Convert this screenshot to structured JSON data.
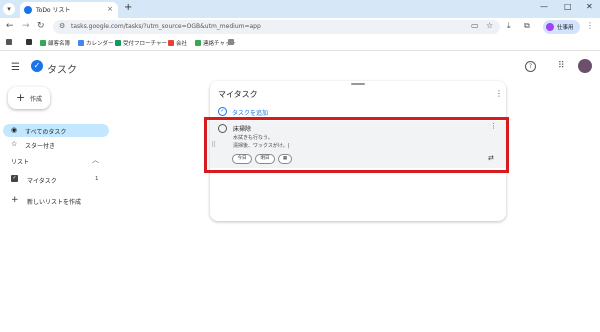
{
  "browser": {
    "tab_title": "ToDo リスト",
    "tab_close": "×",
    "new_tab": "+",
    "url": "tasks.google.com/tasks/?utm_source=OGB&utm_medium=app",
    "profile_label": "仕事用",
    "back": "←",
    "forward": "→",
    "reload": "↻",
    "minimize": "—",
    "maximize": "□",
    "close": "✕"
  },
  "bookmarks": [
    {
      "label": "",
      "color": "#555555"
    },
    {
      "label": "",
      "color": "#333333"
    },
    {
      "label": "顧客名簿",
      "color": "#34a853"
    },
    {
      "label": "カレンダー",
      "color": "#4285f4"
    },
    {
      "label": "受付フローチャート",
      "color": "#0f9d58"
    },
    {
      "label": "会社",
      "color": "#ea4335"
    },
    {
      "label": "連絡チャット",
      "color": "#34a853"
    },
    {
      "label": "",
      "color": "#888888"
    }
  ],
  "app": {
    "name": "タスク",
    "create_label": "作成",
    "all_tasks_label": "すべてのタスク",
    "starred_label": "スター付き",
    "lists_header": "リスト",
    "list_name": "マイタスク",
    "list_count": "1",
    "new_list_label": "新しいリストを作成"
  },
  "card": {
    "title": "マイタスク",
    "add_task_label": "タスクを追加",
    "task": {
      "title": "床掃除",
      "notes": "水拭きも行なう。\n清掃後、ワックスがけ。|",
      "chip_today": "今日",
      "chip_tomorrow": "明日"
    }
  },
  "colors": {
    "accent": "#1a73e8",
    "selected_nav": "#c2e7ff",
    "highlight_border": "#d71920"
  },
  "icons": [
    "hamburger-icon",
    "tasks-logo-icon",
    "help-icon",
    "apps-grid-icon",
    "plus-icon",
    "check-circle-icon",
    "star-icon",
    "chevron-up-icon",
    "checkbox-icon",
    "more-vert-icon",
    "drag-handle-icon",
    "calendar-icon",
    "repeat-icon"
  ]
}
